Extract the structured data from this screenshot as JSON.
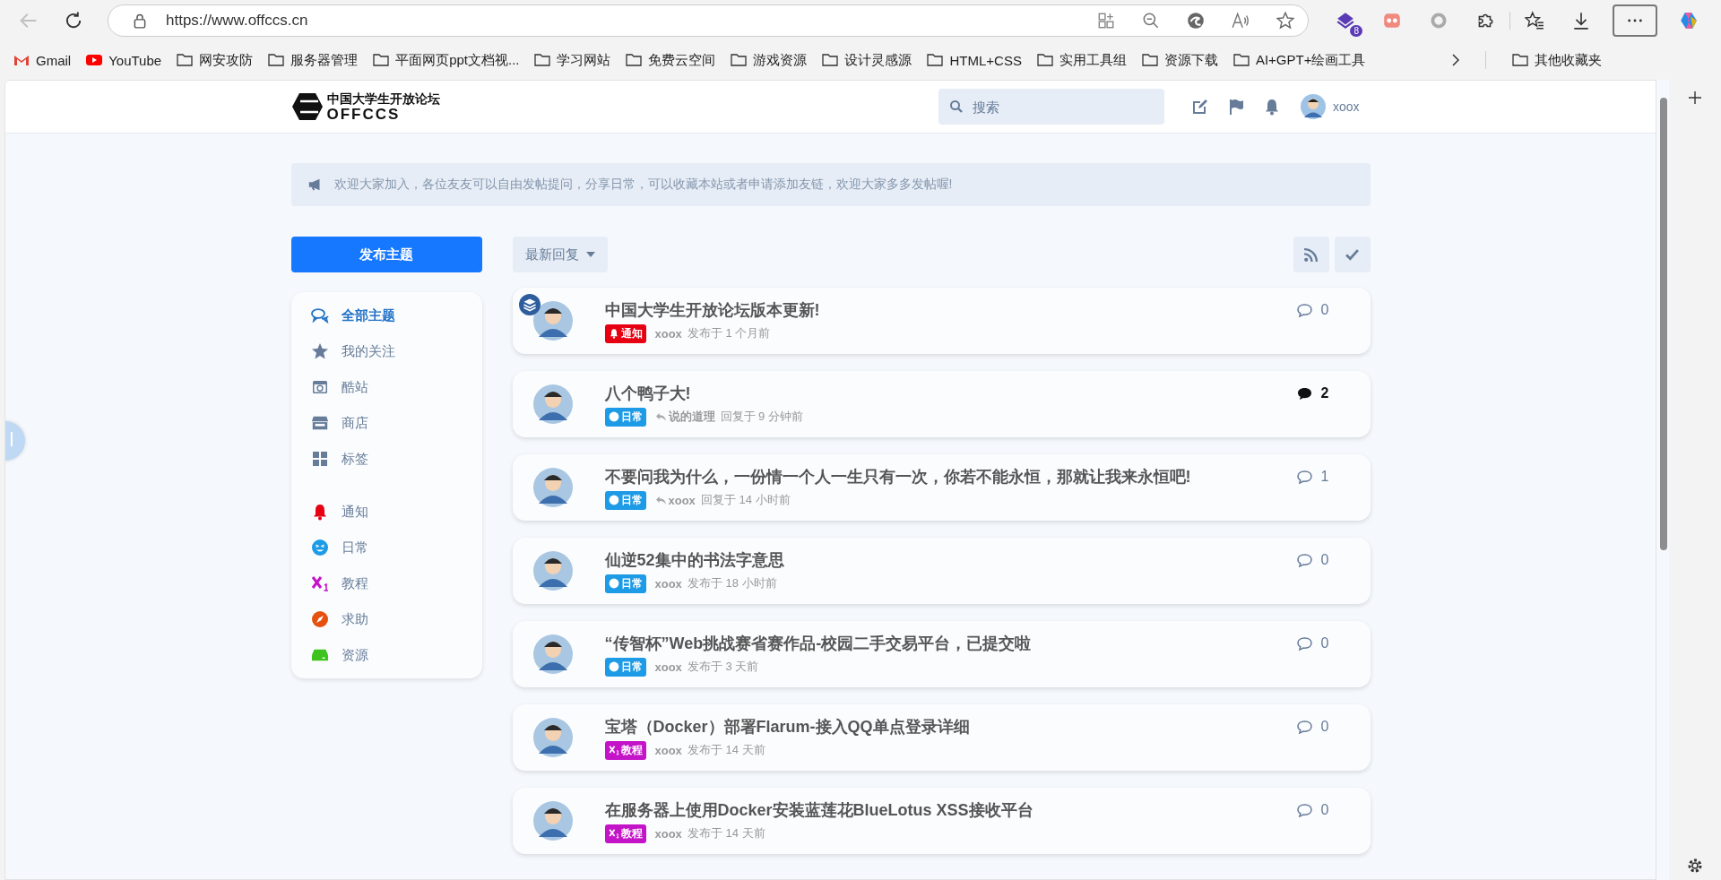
{
  "browser": {
    "url": "https://www.offccs.cn",
    "extension_badge": "8",
    "bookmarks": [
      {
        "kind": "gmail",
        "label": "Gmail"
      },
      {
        "kind": "youtube",
        "label": "YouTube"
      },
      {
        "kind": "folder",
        "label": "网安攻防"
      },
      {
        "kind": "folder",
        "label": "服务器管理"
      },
      {
        "kind": "folder",
        "label": "平面网页ppt文档视..."
      },
      {
        "kind": "folder",
        "label": "学习网站"
      },
      {
        "kind": "folder",
        "label": "免费云空间"
      },
      {
        "kind": "folder",
        "label": "游戏资源"
      },
      {
        "kind": "folder",
        "label": "设计灵感源"
      },
      {
        "kind": "folder",
        "label": "HTML+CSS"
      },
      {
        "kind": "folder",
        "label": "实用工具组"
      },
      {
        "kind": "folder",
        "label": "资源下载"
      },
      {
        "kind": "folder",
        "label": "AI+GPT+绘画工具"
      }
    ],
    "other_bookmarks": "其他收藏夹"
  },
  "site": {
    "logo_cn": "中国大学生开放论坛",
    "logo_en": "OFFCCS",
    "search_placeholder": "搜索",
    "username": "xoox"
  },
  "announcement": "欢迎大家加入，各位友友可以自由发帖提问，分享日常，可以收藏本站或者申请添加友链，欢迎大家多多发帖喔!",
  "compose_button": "发布主题",
  "sort_button": "最新回复",
  "nav": [
    {
      "kind": "comments",
      "label": "全部主题",
      "selected": true
    },
    {
      "kind": "star",
      "label": "我的关注",
      "selected": false
    },
    {
      "kind": "camera",
      "label": "酷站",
      "selected": false
    },
    {
      "kind": "store",
      "label": "商店",
      "selected": false
    },
    {
      "kind": "grid",
      "label": "标签",
      "selected": false
    }
  ],
  "tags": [
    {
      "kind": "bell",
      "label": "通知",
      "color": "#e60012"
    },
    {
      "kind": "smile",
      "label": "日常",
      "color": "#1e9be6"
    },
    {
      "kind": "subscript",
      "label": "教程",
      "color": "#c414c8"
    },
    {
      "kind": "compass",
      "label": "求助",
      "color": "#e5520f"
    },
    {
      "kind": "drive",
      "label": "资源",
      "color": "#3ec21d"
    }
  ],
  "topics": [
    {
      "title": "中国大学生开放论坛版本更新!",
      "pinned": true,
      "tag": {
        "kind": "bell",
        "label": "通知",
        "color": "#e60012"
      },
      "reply": false,
      "author": "xoox",
      "text": "发布于 1 个月前",
      "count": "0",
      "unread": false
    },
    {
      "title": "八个鸭子大!",
      "pinned": false,
      "tag": {
        "kind": "smile",
        "label": "日常",
        "color": "#1e9be6"
      },
      "reply": true,
      "author": "说的道理",
      "text": "回复于 9 分钟前",
      "count": "2",
      "unread": true
    },
    {
      "title": "不要问我为什么，一份情一个人一生只有一次，你若不能永恒，那就让我来永恒吧!",
      "pinned": false,
      "tag": {
        "kind": "smile",
        "label": "日常",
        "color": "#1e9be6"
      },
      "reply": true,
      "author": "xoox",
      "text": "回复于 14 小时前",
      "count": "1",
      "unread": false
    },
    {
      "title": "仙逆52集中的书法字意思",
      "pinned": false,
      "tag": {
        "kind": "smile",
        "label": "日常",
        "color": "#1e9be6"
      },
      "reply": false,
      "author": "xoox",
      "text": "发布于 18 小时前",
      "count": "0",
      "unread": false
    },
    {
      "title": "“传智杯”Web挑战赛省赛作品-校园二手交易平台，已提交啦",
      "pinned": false,
      "tag": {
        "kind": "smile",
        "label": "日常",
        "color": "#1e9be6"
      },
      "reply": false,
      "author": "xoox",
      "text": "发布于 3 天前",
      "count": "0",
      "unread": false
    },
    {
      "title": "宝塔（Docker）部署Flarum-接入QQ单点登录详细",
      "pinned": false,
      "tag": {
        "kind": "subscript",
        "label": "教程",
        "color": "#c414c8"
      },
      "reply": false,
      "author": "xoox",
      "text": "发布于 14 天前",
      "count": "0",
      "unread": false
    },
    {
      "title": "在服务器上使用Docker安装蓝莲花BlueLotus XSS接收平台",
      "pinned": false,
      "tag": {
        "kind": "subscript",
        "label": "教程",
        "color": "#c414c8"
      },
      "reply": false,
      "author": "xoox",
      "text": "发布于 14 天前",
      "count": "0",
      "unread": false
    }
  ]
}
